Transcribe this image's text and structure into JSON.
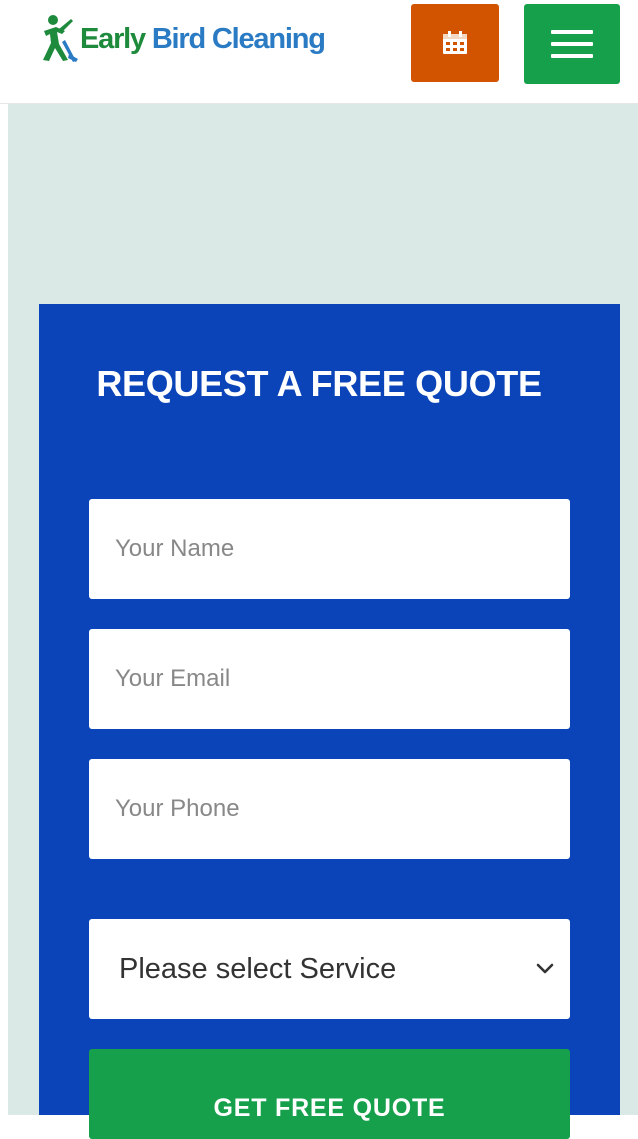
{
  "header": {
    "logo": {
      "word1": "Early",
      "word2": "Bird Cleaning",
      "icon": "bird-cleaner-logo-icon"
    },
    "calendar_button": {
      "icon": "calendar-icon"
    },
    "menu_button": {
      "icon": "hamburger-menu-icon"
    }
  },
  "quote_form": {
    "title": "REQUEST A FREE QUOTE",
    "name_placeholder": "Your Name",
    "email_placeholder": "Your Email",
    "phone_placeholder": "Your Phone",
    "service_select": {
      "selected": "Please select Service",
      "icon": "chevron-down-icon"
    },
    "submit_label": "GET FREE QUOTE"
  },
  "colors": {
    "header_bg": "#ffffff",
    "calendar_button": "#d35400",
    "menu_button": "#16a04b",
    "hero_bg": "#dbe9e6",
    "form_bg": "#0a44b8",
    "submit_button": "#16a04b",
    "logo_green": "#1e8a3c",
    "logo_blue": "#2a7bc4"
  }
}
